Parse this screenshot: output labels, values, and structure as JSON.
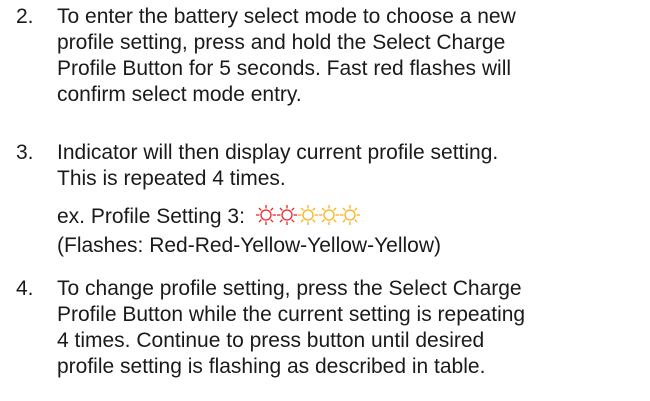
{
  "steps": [
    {
      "number": "2.",
      "lines": [
        "To enter the battery select mode to choose a new",
        "profile setting, press and hold the Select Charge",
        "Profile Button for 5 seconds. Fast red flashes will",
        "confirm select mode entry."
      ]
    },
    {
      "number": "3.",
      "lines": [
        "Indicator will then display current profile setting.",
        "This is repeated 4 times."
      ],
      "example": {
        "label": "ex. Profile Setting 3:",
        "flashes": [
          "red",
          "red",
          "yellow",
          "yellow",
          "yellow"
        ],
        "caption": "(Flashes: Red-Red-Yellow-Yellow-Yellow)"
      }
    },
    {
      "number": "4.",
      "lines": [
        "To change profile setting, press the Select Charge",
        "Profile Button while the current setting is repeating",
        "4 times. Continue to press button until desired",
        "profile setting is flashing as described in table."
      ]
    }
  ],
  "colors": {
    "red": "#e8262a",
    "yellow": "#f6b21a"
  }
}
